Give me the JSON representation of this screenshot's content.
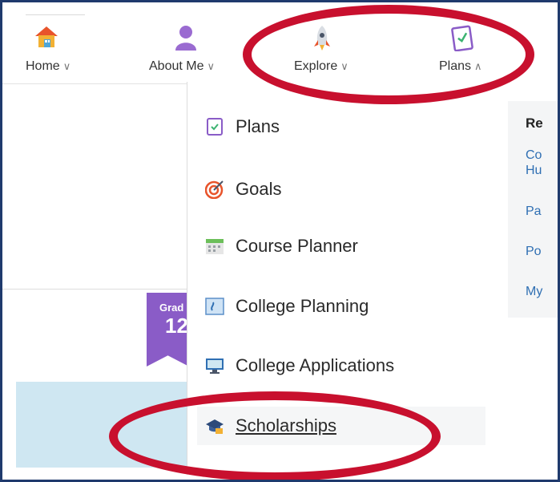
{
  "nav": {
    "items": [
      {
        "label": "Home",
        "icon": "house-icon"
      },
      {
        "label": "About Me",
        "icon": "person-icon"
      },
      {
        "label": "Explore",
        "icon": "rocket-icon"
      },
      {
        "label": "Plans",
        "icon": "clipboard-icon"
      }
    ]
  },
  "grade": {
    "label": "Grad",
    "number": "12"
  },
  "menu": {
    "items": [
      {
        "label": "Plans",
        "icon": "clipboard-icon"
      },
      {
        "label": "Goals",
        "icon": "target-icon"
      },
      {
        "label": "Course Planner",
        "icon": "calendar-icon"
      },
      {
        "label": "College Planning",
        "icon": "college-planning-icon"
      },
      {
        "label": "College Applications",
        "icon": "monitor-icon"
      },
      {
        "label": "Scholarships",
        "icon": "graduation-cap-icon"
      }
    ]
  },
  "resources": {
    "title": "Re",
    "links": [
      "Co",
      "Hu",
      "Pa",
      "Po",
      "My"
    ]
  },
  "colors": {
    "highlight_oval": "#c8102e",
    "link": "#2f6fb3",
    "grade_badge": "#8a5cc7",
    "frame": "#1f3a6d"
  }
}
